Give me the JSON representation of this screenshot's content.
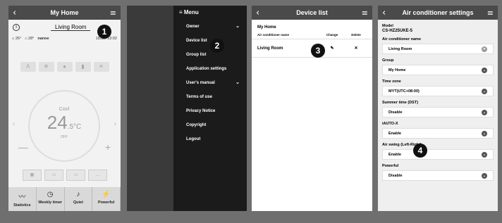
{
  "panel1": {
    "title": "My Home",
    "room": "Living Room",
    "outdoor_temp": "26°",
    "indoor_temp": "28°",
    "brand": "nanoe",
    "date": "18Jan 13:02",
    "mode": "Cool",
    "temp_value": "24",
    "temp_decimal": ".5",
    "temp_unit": "°C",
    "fan_label": "OFF",
    "step": "1",
    "tabs": [
      {
        "label": "Statistics",
        "icon": "statistics-icon"
      },
      {
        "label": "Weekly timer",
        "icon": "timer-icon"
      },
      {
        "label": "Quiet",
        "icon": "quiet-icon"
      },
      {
        "label": "Powerful",
        "icon": "powerful-icon"
      }
    ]
  },
  "panel2": {
    "menu_title": "Menu",
    "step": "2",
    "items": [
      "Owner",
      "Device list",
      "Group list",
      "Application settings",
      "User's manual",
      "Terms of use",
      "Privacy Notice",
      "Copyright",
      "Logout"
    ]
  },
  "panel3": {
    "title": "Device list",
    "home": "My Home",
    "col_name": "Air conditioner name",
    "col_change": "Change",
    "col_delete": "Delete",
    "device": "Living Room",
    "step": "3"
  },
  "panel4": {
    "title": "Air conditioner settings",
    "model_label": "Model",
    "model_value": "CS-HZ25UKE-5",
    "name_label": "Air conditioner name",
    "name_value": "Living Room",
    "group_label": "Group",
    "group_value": "My Home",
    "tz_label": "Time zone",
    "tz_value": "MYT(UTC+08:00)",
    "dst_label": "Summer time (DST)",
    "dst_value": "Disable",
    "iauto_label": "iAUTO-X",
    "iauto_value": "Enable",
    "swing_label": "Air swing (Left-Right)",
    "swing_value": "Enable",
    "powerful_label": "Powerful",
    "powerful_value": "Disable",
    "step": "4"
  }
}
